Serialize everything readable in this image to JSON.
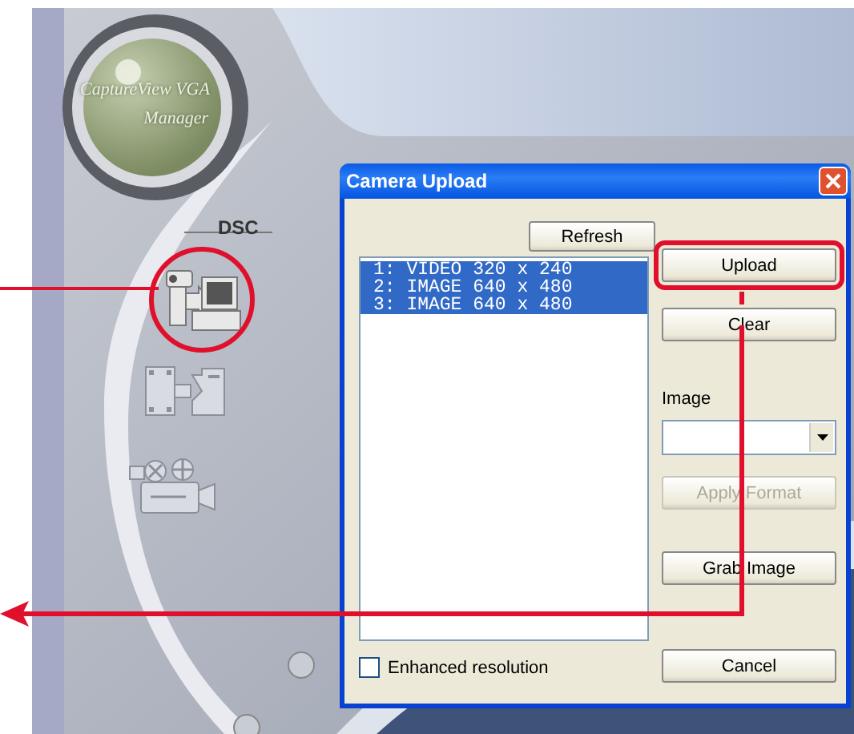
{
  "app": {
    "logo_lines": [
      "CaptureView VGA",
      "Manager"
    ],
    "mode_label": "DSC",
    "mode_icons": [
      {
        "kind": "camera-to-pc",
        "highlighted": true
      },
      {
        "kind": "film-to-card",
        "highlighted": false
      },
      {
        "kind": "movie-camera",
        "highlighted": false
      }
    ]
  },
  "dialog": {
    "title": "Camera Upload",
    "refresh_button": "Refresh",
    "files": [
      {
        "label": "1: VIDEO 320 x 240",
        "selected": true
      },
      {
        "label": "2: IMAGE 640 x 480",
        "selected": true
      },
      {
        "label": "3: IMAGE 640 x 480",
        "selected": true
      }
    ],
    "action_buttons": [
      {
        "kind": "upload",
        "label": "Upload",
        "disabled": false,
        "highlighted": true
      },
      {
        "kind": "clear",
        "label": "Clear",
        "disabled": false,
        "highlighted": false
      }
    ],
    "format_label": "Image",
    "format_buttons": [
      {
        "kind": "apply",
        "label": "Apply Format",
        "disabled": true
      },
      {
        "kind": "grab",
        "label": "Grab Image",
        "disabled": false
      }
    ],
    "enhanced_resolution": {
      "label": "Enhanced resolution",
      "checked": false
    },
    "cancel_button": "Cancel"
  }
}
